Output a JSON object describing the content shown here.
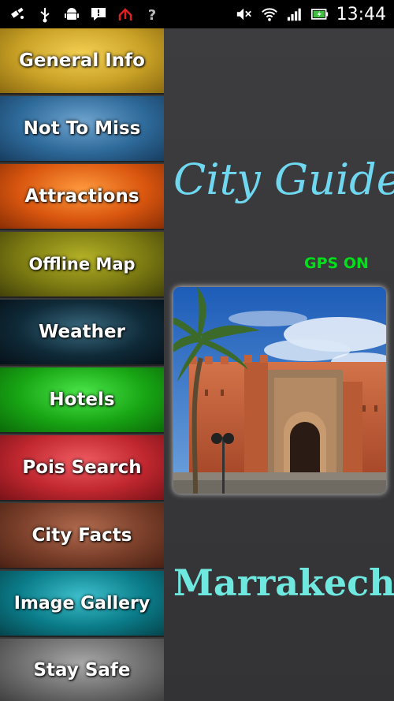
{
  "status_bar": {
    "time": "13:44",
    "left_icons": [
      "satellite-icon",
      "usb-icon",
      "android-icon",
      "message-icon",
      "upload-icon",
      "wifi-question-icon"
    ],
    "right_icons": [
      "mute-icon",
      "wifi-icon",
      "signal-icon",
      "battery-icon"
    ]
  },
  "menu": {
    "items": [
      {
        "label": "General Info",
        "color": "#c9a126"
      },
      {
        "label": "Not To Miss",
        "color": "#2e6a9a"
      },
      {
        "label": "Attractions",
        "color": "#d9560f"
      },
      {
        "label": "Offline Map",
        "color": "#7b7a12"
      },
      {
        "label": "Weather",
        "color": "#0f2a38"
      },
      {
        "label": "Hotels",
        "color": "#18a514"
      },
      {
        "label": "Pois Search",
        "color": "#c0272f"
      },
      {
        "label": "City Facts",
        "color": "#7a3f2a"
      },
      {
        "label": "Image Gallery",
        "color": "#0b7d8a"
      },
      {
        "label": "Stay Safe",
        "color": "#6e6e6e"
      }
    ]
  },
  "main": {
    "title": "City Guide",
    "gps_status": "GPS ON",
    "city_name": "Marrakech"
  },
  "colors": {
    "title": "#6fd8f0",
    "gps": "#00e01a",
    "city": "#6fe8e0",
    "background": "#3a3a3a"
  }
}
